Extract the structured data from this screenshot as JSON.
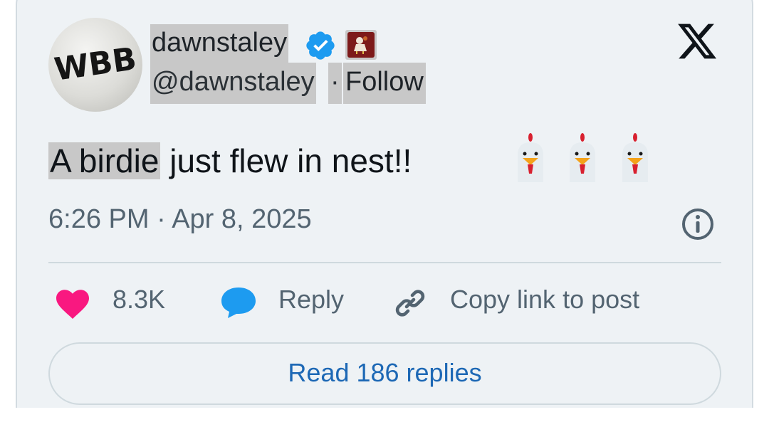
{
  "author": {
    "display_name": "dawnstaley",
    "handle": "@dawnstaley",
    "separator": "·",
    "follow_label": "Follow",
    "avatar_text": "WBB"
  },
  "icons": {
    "verified": "verified-badge-icon",
    "affiliation": "gamecocks-affiliation-icon",
    "platform": "x-logo-icon",
    "info": "info-icon",
    "like": "heart-icon",
    "reply": "reply-bubble-icon",
    "copy": "link-icon"
  },
  "tweet": {
    "highlighted_text": "A birdie",
    "text": " just flew in nest!!",
    "emoji": "🐔 🐔 🐔"
  },
  "timestamp": "6:26 PM · Apr 8, 2025",
  "actions": {
    "likes_count": "8.3K",
    "reply_label": "Reply",
    "copy_label": "Copy link to post"
  },
  "read_replies_label": "Read 186 replies",
  "colors": {
    "heart": "#f91880",
    "reply_bubble": "#1d9bf0",
    "verified": "#1d9bf0",
    "link_text": "#1d68b5",
    "muted": "#536471"
  }
}
